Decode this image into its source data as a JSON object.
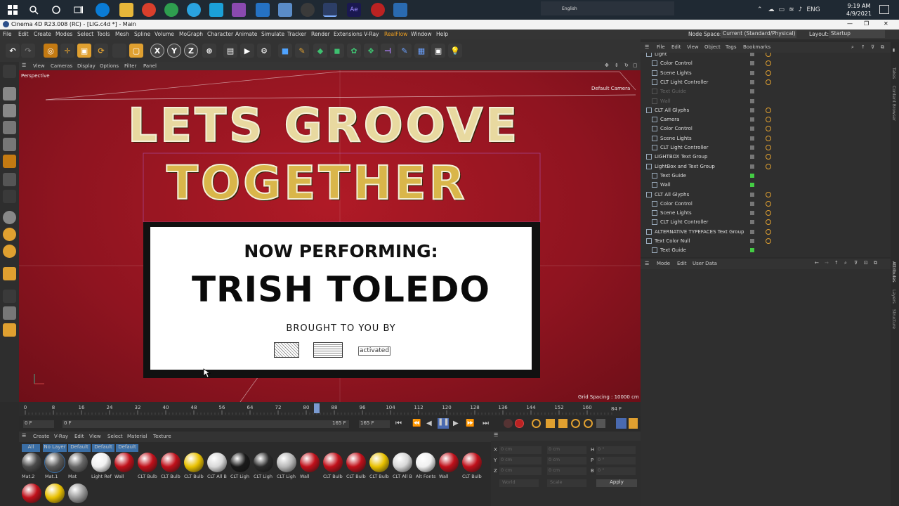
{
  "taskbar": {
    "search_icon": "search-icon",
    "lang_label": "English",
    "keyboard": "ENG",
    "time": "9:19 AM",
    "date": "4/9/2021"
  },
  "window": {
    "title": "Cinema 4D R23.008 (RC) - [LIG.c4d *] - Main"
  },
  "menubar": {
    "items": [
      "File",
      "Edit",
      "Create",
      "Modes",
      "Select",
      "Tools",
      "Mesh",
      "Spline",
      "Volume",
      "MoGraph",
      "Character",
      "Animate",
      "Simulate",
      "Tracker",
      "Render",
      "Extensions",
      "V-Ray",
      "RealFlow",
      "Window",
      "Help"
    ],
    "node_space_label": "Node Space:",
    "node_space_value": "Current (Standard/Physical)",
    "layout_label": "Layout:",
    "layout_value": "Startup"
  },
  "toolbar": {
    "axis_x": "X",
    "axis_y": "Y",
    "axis_z": "Z"
  },
  "viewport_menu": [
    "View",
    "Cameras",
    "Display",
    "Options",
    "Filter",
    "Panel"
  ],
  "viewport": {
    "view_name": "Perspective",
    "camera": "Default Camera",
    "grid_spacing": "Grid Spacing : 10000 cm",
    "headline_1": "LETS GROOVE",
    "headline_2": "TOGETHER",
    "now_performing": "NOW PERFORMING:",
    "performer": "TRISH TOLEDO",
    "brought_by": "BROUGHT TO YOU BY",
    "sponsor_3": "activated"
  },
  "timeline": {
    "ticks": [
      "0",
      "8",
      "16",
      "24",
      "32",
      "40",
      "48",
      "56",
      "64",
      "72",
      "80",
      "88",
      "96",
      "104",
      "112",
      "120",
      "128",
      "136",
      "144",
      "152",
      "160"
    ],
    "current_frame": "84 F",
    "start_field": "0 F",
    "start_field2": "0 F",
    "end_field": "165 F",
    "end_field2": "165 F"
  },
  "materials": {
    "menu": [
      "Create",
      "V-Ray",
      "Edit",
      "View",
      "Select",
      "Material",
      "Texture"
    ],
    "filters": [
      "All",
      "No Layer",
      "Default",
      "Default",
      "Default"
    ],
    "items": [
      {
        "label": "Mat.2",
        "color": "#4a4a4a"
      },
      {
        "label": "Mat.1",
        "color": "#5a5a5a"
      },
      {
        "label": "Mat",
        "color": "#666666"
      },
      {
        "label": "Light Ref",
        "color": "#f0f0f0"
      },
      {
        "label": "Wall",
        "color": "#c0101a"
      },
      {
        "label": "CLT Bulb",
        "color": "#c0101a"
      },
      {
        "label": "CLT Bulb",
        "color": "#c0101a"
      },
      {
        "label": "CLT Bulb",
        "color": "#e8c000"
      },
      {
        "label": "CLT All B",
        "color": "#d8d8d8"
      },
      {
        "label": "CLT Ligh",
        "color": "#1a1a1a"
      },
      {
        "label": "CLT Ligh",
        "color": "#2a2a2a"
      },
      {
        "label": "CLT Ligh",
        "color": "#b8b8b8"
      },
      {
        "label": "Wall",
        "color": "#c0101a"
      },
      {
        "label": "CLT Bulb",
        "color": "#c0101a"
      },
      {
        "label": "CLT Bulb",
        "color": "#c0101a"
      },
      {
        "label": "CLT Bulb",
        "color": "#e8c000"
      },
      {
        "label": "CLT All B",
        "color": "#d8d8d8"
      },
      {
        "label": "Alt Fonts",
        "color": "#f0f0f0"
      },
      {
        "label": "Wall",
        "color": "#c0101a"
      },
      {
        "label": "CLT Bulb",
        "color": "#c0101a"
      }
    ],
    "row2": [
      {
        "color": "#c0101a"
      },
      {
        "color": "#e8c000"
      },
      {
        "color": "#9a9a9a"
      }
    ]
  },
  "coords": {
    "x_label": "X",
    "y_label": "Y",
    "z_label": "Z",
    "x_val": "0 cm",
    "y_val": "0 cm",
    "z_val": "0 cm",
    "x2_val": "0 cm",
    "y2_val": "0 cm",
    "z2_val": "0 cm",
    "h_label": "H",
    "p_label": "P",
    "b_label": "B",
    "h_val": "0 °",
    "p_val": "0 °",
    "b_val": "0 °",
    "mode1": "World",
    "mode2": "Scale",
    "apply": "Apply"
  },
  "object_manager": {
    "menu": [
      "File",
      "Edit",
      "View",
      "Object",
      "Tags",
      "Bookmarks"
    ],
    "rows": [
      {
        "name": "Light",
        "indent": 0,
        "type": "light"
      },
      {
        "name": "Color Control",
        "indent": 1,
        "type": "null"
      },
      {
        "name": "Scene Lights",
        "indent": 1,
        "type": "null"
      },
      {
        "name": "CLT Light Controller",
        "indent": 1,
        "type": "null"
      },
      {
        "name": "Text Guide",
        "indent": 1,
        "type": "dim"
      },
      {
        "name": "Wall",
        "indent": 1,
        "type": "dim"
      },
      {
        "name": "CLT All Glyphs",
        "indent": 0,
        "type": "null"
      },
      {
        "name": "Camera",
        "indent": 1,
        "type": "camera"
      },
      {
        "name": "Color Control",
        "indent": 1,
        "type": "null"
      },
      {
        "name": "Scene Lights",
        "indent": 1,
        "type": "null"
      },
      {
        "name": "CLT Light Controller",
        "indent": 1,
        "type": "null"
      },
      {
        "name": "LIGHTBOX Text Group",
        "indent": 0,
        "type": "null"
      },
      {
        "name": "LightBox and Text Group",
        "indent": 0,
        "type": "null"
      },
      {
        "name": "Text Guide",
        "indent": 1,
        "type": "plain"
      },
      {
        "name": "Wall",
        "indent": 1,
        "type": "plain"
      },
      {
        "name": "CLT All Glyphs",
        "indent": 0,
        "type": "null"
      },
      {
        "name": "Color Control",
        "indent": 1,
        "type": "null"
      },
      {
        "name": "Scene Lights",
        "indent": 1,
        "type": "null"
      },
      {
        "name": "CLT Light Controller",
        "indent": 1,
        "type": "null"
      },
      {
        "name": "ALTERNATIVE TYPEFACES Text Group",
        "indent": 0,
        "type": "null"
      },
      {
        "name": "Text Color Null",
        "indent": 0,
        "type": "null"
      },
      {
        "name": "Text Guide",
        "indent": 1,
        "type": "plain"
      }
    ]
  },
  "attributes": {
    "menu": [
      "Mode",
      "Edit",
      "User Data"
    ]
  },
  "right_strip": [
    "Attributes",
    "Layers",
    "Structure",
    "Takes",
    "Content Browser"
  ],
  "colors": {
    "accent": "#e0a030",
    "viewport_red": "#9e1722",
    "selected_blue": "#3a6ea5"
  }
}
